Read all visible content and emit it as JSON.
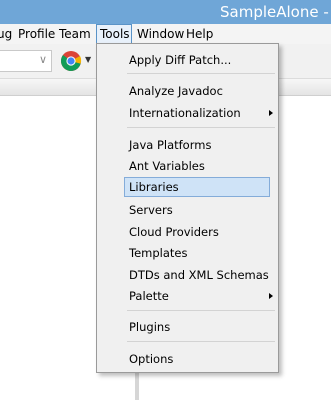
{
  "window": {
    "title": "SampleAlone - N"
  },
  "menubar": {
    "items": [
      {
        "label": "ug"
      },
      {
        "label": "Profile"
      },
      {
        "label": "Team"
      },
      {
        "label": "Tools",
        "active": true
      },
      {
        "label": "Window"
      },
      {
        "label": "Help"
      }
    ]
  },
  "toolbar": {
    "config_combo": {
      "value": ""
    },
    "browser_button": {
      "icon": "chrome-icon"
    }
  },
  "tools_menu": {
    "items": [
      {
        "label": "Apply Diff Patch..."
      },
      {
        "label": "Analyze Javadoc"
      },
      {
        "label": "Internationalization",
        "submenu": true
      },
      {
        "label": "Java Platforms"
      },
      {
        "label": "Ant Variables"
      },
      {
        "label": "Libraries",
        "selected": true
      },
      {
        "label": "Servers"
      },
      {
        "label": "Cloud Providers"
      },
      {
        "label": "Templates"
      },
      {
        "label": "DTDs and XML Schemas"
      },
      {
        "label": "Palette",
        "submenu": true
      },
      {
        "label": "Plugins"
      },
      {
        "label": "Options"
      }
    ]
  },
  "colors": {
    "titlebar": "#6fa6d7",
    "menu_background": "#f0f0f0",
    "selection": "#cfe3f7",
    "selection_border": "#84acd9"
  }
}
